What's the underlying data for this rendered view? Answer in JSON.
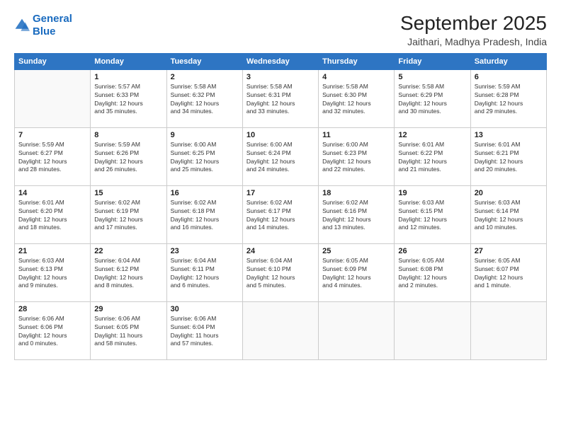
{
  "logo": {
    "line1": "General",
    "line2": "Blue"
  },
  "title": "September 2025",
  "subtitle": "Jaithari, Madhya Pradesh, India",
  "weekdays": [
    "Sunday",
    "Monday",
    "Tuesday",
    "Wednesday",
    "Thursday",
    "Friday",
    "Saturday"
  ],
  "weeks": [
    [
      {
        "day": "",
        "info": ""
      },
      {
        "day": "1",
        "info": "Sunrise: 5:57 AM\nSunset: 6:33 PM\nDaylight: 12 hours\nand 35 minutes."
      },
      {
        "day": "2",
        "info": "Sunrise: 5:58 AM\nSunset: 6:32 PM\nDaylight: 12 hours\nand 34 minutes."
      },
      {
        "day": "3",
        "info": "Sunrise: 5:58 AM\nSunset: 6:31 PM\nDaylight: 12 hours\nand 33 minutes."
      },
      {
        "day": "4",
        "info": "Sunrise: 5:58 AM\nSunset: 6:30 PM\nDaylight: 12 hours\nand 32 minutes."
      },
      {
        "day": "5",
        "info": "Sunrise: 5:58 AM\nSunset: 6:29 PM\nDaylight: 12 hours\nand 30 minutes."
      },
      {
        "day": "6",
        "info": "Sunrise: 5:59 AM\nSunset: 6:28 PM\nDaylight: 12 hours\nand 29 minutes."
      }
    ],
    [
      {
        "day": "7",
        "info": "Sunrise: 5:59 AM\nSunset: 6:27 PM\nDaylight: 12 hours\nand 28 minutes."
      },
      {
        "day": "8",
        "info": "Sunrise: 5:59 AM\nSunset: 6:26 PM\nDaylight: 12 hours\nand 26 minutes."
      },
      {
        "day": "9",
        "info": "Sunrise: 6:00 AM\nSunset: 6:25 PM\nDaylight: 12 hours\nand 25 minutes."
      },
      {
        "day": "10",
        "info": "Sunrise: 6:00 AM\nSunset: 6:24 PM\nDaylight: 12 hours\nand 24 minutes."
      },
      {
        "day": "11",
        "info": "Sunrise: 6:00 AM\nSunset: 6:23 PM\nDaylight: 12 hours\nand 22 minutes."
      },
      {
        "day": "12",
        "info": "Sunrise: 6:01 AM\nSunset: 6:22 PM\nDaylight: 12 hours\nand 21 minutes."
      },
      {
        "day": "13",
        "info": "Sunrise: 6:01 AM\nSunset: 6:21 PM\nDaylight: 12 hours\nand 20 minutes."
      }
    ],
    [
      {
        "day": "14",
        "info": "Sunrise: 6:01 AM\nSunset: 6:20 PM\nDaylight: 12 hours\nand 18 minutes."
      },
      {
        "day": "15",
        "info": "Sunrise: 6:02 AM\nSunset: 6:19 PM\nDaylight: 12 hours\nand 17 minutes."
      },
      {
        "day": "16",
        "info": "Sunrise: 6:02 AM\nSunset: 6:18 PM\nDaylight: 12 hours\nand 16 minutes."
      },
      {
        "day": "17",
        "info": "Sunrise: 6:02 AM\nSunset: 6:17 PM\nDaylight: 12 hours\nand 14 minutes."
      },
      {
        "day": "18",
        "info": "Sunrise: 6:02 AM\nSunset: 6:16 PM\nDaylight: 12 hours\nand 13 minutes."
      },
      {
        "day": "19",
        "info": "Sunrise: 6:03 AM\nSunset: 6:15 PM\nDaylight: 12 hours\nand 12 minutes."
      },
      {
        "day": "20",
        "info": "Sunrise: 6:03 AM\nSunset: 6:14 PM\nDaylight: 12 hours\nand 10 minutes."
      }
    ],
    [
      {
        "day": "21",
        "info": "Sunrise: 6:03 AM\nSunset: 6:13 PM\nDaylight: 12 hours\nand 9 minutes."
      },
      {
        "day": "22",
        "info": "Sunrise: 6:04 AM\nSunset: 6:12 PM\nDaylight: 12 hours\nand 8 minutes."
      },
      {
        "day": "23",
        "info": "Sunrise: 6:04 AM\nSunset: 6:11 PM\nDaylight: 12 hours\nand 6 minutes."
      },
      {
        "day": "24",
        "info": "Sunrise: 6:04 AM\nSunset: 6:10 PM\nDaylight: 12 hours\nand 5 minutes."
      },
      {
        "day": "25",
        "info": "Sunrise: 6:05 AM\nSunset: 6:09 PM\nDaylight: 12 hours\nand 4 minutes."
      },
      {
        "day": "26",
        "info": "Sunrise: 6:05 AM\nSunset: 6:08 PM\nDaylight: 12 hours\nand 2 minutes."
      },
      {
        "day": "27",
        "info": "Sunrise: 6:05 AM\nSunset: 6:07 PM\nDaylight: 12 hours\nand 1 minute."
      }
    ],
    [
      {
        "day": "28",
        "info": "Sunrise: 6:06 AM\nSunset: 6:06 PM\nDaylight: 12 hours\nand 0 minutes."
      },
      {
        "day": "29",
        "info": "Sunrise: 6:06 AM\nSunset: 6:05 PM\nDaylight: 11 hours\nand 58 minutes."
      },
      {
        "day": "30",
        "info": "Sunrise: 6:06 AM\nSunset: 6:04 PM\nDaylight: 11 hours\nand 57 minutes."
      },
      {
        "day": "",
        "info": ""
      },
      {
        "day": "",
        "info": ""
      },
      {
        "day": "",
        "info": ""
      },
      {
        "day": "",
        "info": ""
      }
    ]
  ]
}
